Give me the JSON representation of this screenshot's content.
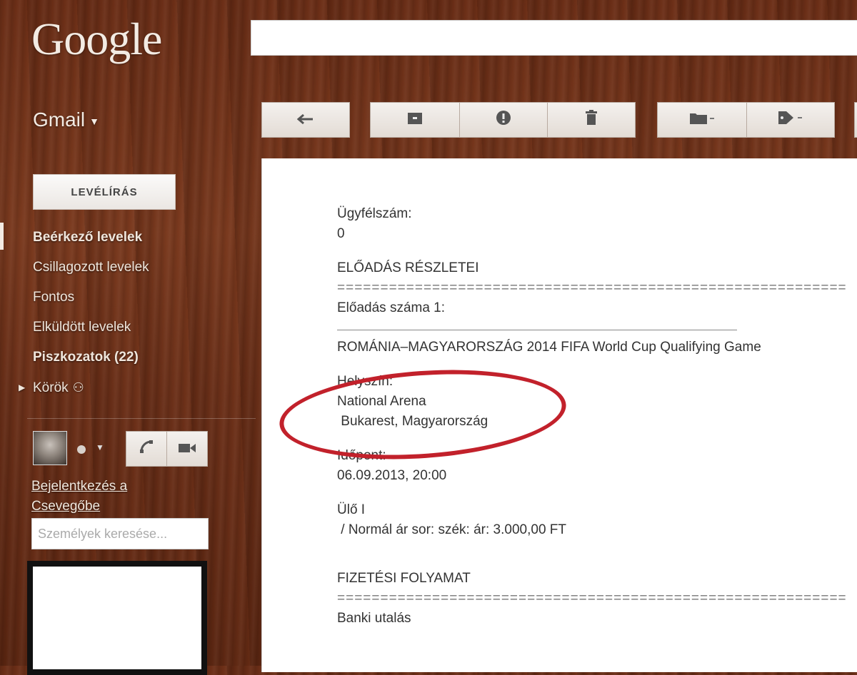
{
  "header": {
    "logo_text": "Google",
    "search_value": ""
  },
  "gmail_label": "Gmail",
  "toolbar": {
    "reply_icon": "reply-icon",
    "archive_icon": "archive-icon",
    "spam_icon": "report-spam-icon",
    "delete_icon": "trash-icon",
    "move_icon": "folder-icon",
    "label_icon": "label-tag-icon"
  },
  "compose_label": "LEVÉLÍRÁS",
  "sidebar": {
    "items": [
      {
        "label": "Beérkező levelek",
        "bold": true
      },
      {
        "label": "Csillagozott levelek",
        "bold": false
      },
      {
        "label": "Fontos",
        "bold": false
      },
      {
        "label": "Elküldött levelek",
        "bold": false
      },
      {
        "label": "Piszkozatok (22)",
        "bold": true
      },
      {
        "label": "Körök",
        "bold": false
      }
    ]
  },
  "chat": {
    "signin_line1": "Bejelentkezés a",
    "signin_line2": "Csevegőbe",
    "search_placeholder": "Személyek keresése..."
  },
  "message": {
    "customer_label": "Ügyfélszám:",
    "customer_value": "0",
    "details_heading": "ELŐADÁS RÉSZLETEI",
    "separator": "===========================================================",
    "performance_number": "Előadás száma 1:",
    "event_title": "ROMÁNIA–MAGYARORSZÁG  2014 FIFA World Cup Qualifying Game",
    "venue_label": "Helyszín:",
    "venue_name": "National Arena",
    "venue_city": " Bukarest, Magyarország",
    "time_label": "Időpont:",
    "time_value": "06.09.2013, 20:00",
    "seat_label": "Ülő I",
    "price_line": " / Normál ár sor: szék: ár: 3.000,00 FT",
    "payment_heading": "FIZETÉSI FOLYAMAT",
    "payment_method": "Banki utalás"
  },
  "colors": {
    "highlight_circle": "#c2212b",
    "wood": "#6a2e17"
  }
}
